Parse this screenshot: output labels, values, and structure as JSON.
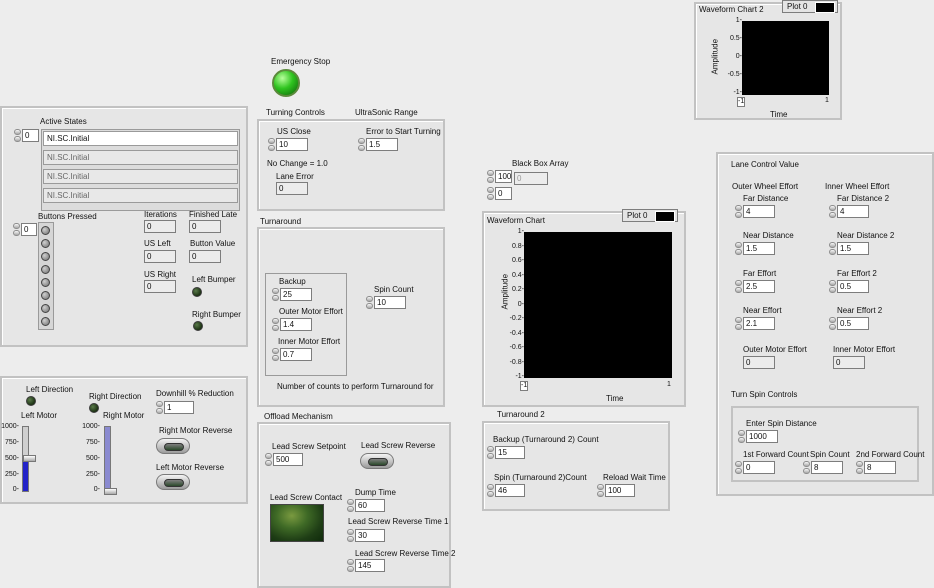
{
  "emergency_stop": {
    "label": "Emergency Stop"
  },
  "active_states": {
    "title": "Active States",
    "index": "0",
    "items": [
      "NI.SC.Initial",
      "NI.SC.Initial",
      "NI.SC.Initial",
      "NI.SC.Initial"
    ]
  },
  "buttons_pressed": {
    "title": "Buttons Pressed",
    "index": "0"
  },
  "indicators": {
    "iterations": {
      "label": "Iterations",
      "value": "0"
    },
    "finished_late": {
      "label": "Finished Late",
      "value": "0"
    },
    "us_left": {
      "label": "US Left",
      "value": "0"
    },
    "button_value": {
      "label": "Button Value",
      "value": "0"
    },
    "us_right": {
      "label": "US Right",
      "value": "0"
    },
    "left_bumper": {
      "label": "Left Bumper"
    },
    "right_bumper": {
      "label": "Right Bumper"
    }
  },
  "motors": {
    "left_direction": "Left Direction",
    "right_direction": "Right Direction",
    "left_motor": "Left Motor",
    "right_motor": "Right Motor",
    "slider_ticks": [
      "1000-",
      "750-",
      "500-",
      "250-",
      "0-"
    ],
    "left_motor_level": 0.5,
    "right_motor_level": 0.0,
    "downhill_label": "Downhill % Reduction",
    "downhill_value": "1",
    "right_motor_reverse": "Right Motor Reverse",
    "left_motor_reverse": "Left Motor Reverse"
  },
  "turning": {
    "title": "Turning Controls",
    "ultrasonic_title": "UltraSonic Range",
    "us_close_label": "US Close",
    "us_close_value": "10",
    "error_label": "Error to Start Turning",
    "error_value": "1.5",
    "no_change": "No Change = 1.0",
    "lane_error_label": "Lane Error",
    "lane_error_value": "0"
  },
  "turnaround": {
    "title": "Turnaround",
    "backup_label": "Backup",
    "backup_value": "25",
    "outer_label": "Outer Motor Effort",
    "outer_value": "1.4",
    "inner_label": "Inner Motor Effort",
    "inner_value": "0.7",
    "spin_label": "Spin  Count",
    "spin_value": "10",
    "note": "Number of counts to perform Turnaround for"
  },
  "offload": {
    "title": "Offload Mechanism",
    "setpoint_label": "Lead Screw Setpoint",
    "setpoint_value": "500",
    "reverse_label": "Lead Screw Reverse",
    "contact_label": "Lead Screw Contact",
    "dump_label": "Dump Time",
    "dump_value": "60",
    "rev1_label": "Lead Screw Reverse Time 1",
    "rev1_value": "30",
    "rev2_label": "Lead Screw Reverse Time 2",
    "rev2_value": "145"
  },
  "black_box": {
    "label": "Black Box Array",
    "index1": "100",
    "index2": "0",
    "value": "0"
  },
  "waveform_chart": {
    "title": "Waveform Chart",
    "plot_label": "Plot 0",
    "ylabel": "Amplitude",
    "xlabel": "Time",
    "yticks": [
      "1-",
      "0.8-",
      "0.6-",
      "0.4-",
      "0.2-",
      "0-",
      "-0.2-",
      "-0.4-",
      "-0.6-",
      "-0.8-",
      "-1-"
    ],
    "xticks": [
      "-1",
      "1"
    ]
  },
  "waveform_chart2": {
    "title": "Waveform Chart 2",
    "plot_label": "Plot 0",
    "ylabel": "Amplitude",
    "xlabel": "Time",
    "yticks": [
      "1-",
      "0.5-",
      "0-",
      "-0.5-",
      "-1-"
    ],
    "xticks": [
      "-1",
      "1"
    ]
  },
  "turnaround2": {
    "title": "Turnaround 2",
    "backup_label": "Backup (Turnaround 2) Count",
    "backup_value": "15",
    "spin_label": "Spin  (Turnaround 2)Count",
    "spin_value": "46",
    "reload_label": "Reload Wait Time",
    "reload_value": "100"
  },
  "lane_control": {
    "title": "Lane Control Value",
    "outer_title": "Outer Wheel Effort",
    "inner_title": "Inner Wheel Effort",
    "far_distance": {
      "label": "Far Distance",
      "value": "4"
    },
    "far_distance2": {
      "label": "Far Distance 2",
      "value": "4"
    },
    "near_distance": {
      "label": "Near Distance",
      "value": "1.5"
    },
    "near_distance2": {
      "label": "Near Distance 2",
      "value": "1.5"
    },
    "far_effort": {
      "label": "Far Effort",
      "value": "2.5"
    },
    "far_effort2": {
      "label": "Far Effort 2",
      "value": "0.5"
    },
    "near_effort": {
      "label": "Near Effort",
      "value": "2.1"
    },
    "near_effort2": {
      "label": "Near Effort 2",
      "value": "0.5"
    },
    "outer_motor_effort": {
      "label": "Outer Motor Effort",
      "value": "0"
    },
    "inner_motor_effort": {
      "label": "Inner Motor Effort",
      "value": "0"
    }
  },
  "turn_spin": {
    "title": "Turn Spin Controls",
    "enter_label": "Enter Spin Distance",
    "enter_value": "1000",
    "first_label": "1st Forward Count",
    "first_value": "0",
    "spin_label": "Spin Count",
    "spin_value": "8",
    "second_label": "2nd Forward Count",
    "second_value": "8"
  }
}
